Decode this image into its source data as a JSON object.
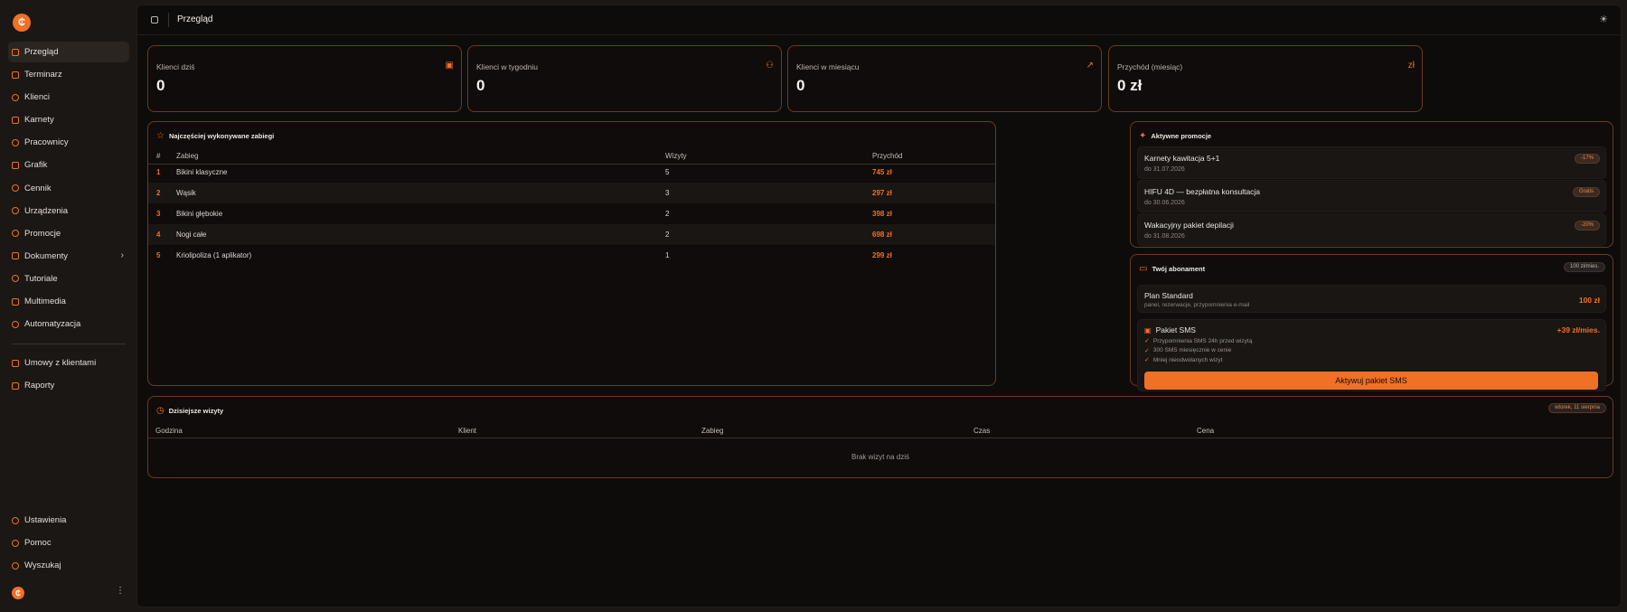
{
  "app": {
    "logo_char": "₵"
  },
  "sidebar": {
    "items": [
      {
        "label": "Przegląd"
      },
      {
        "label": "Terminarz"
      },
      {
        "label": "Klienci"
      },
      {
        "label": "Karnety"
      },
      {
        "label": "Pracownicy"
      },
      {
        "label": "Grafik"
      },
      {
        "label": "Cennik"
      },
      {
        "label": "Urządzenia"
      },
      {
        "label": "Promocje"
      },
      {
        "label": "Dokumenty"
      },
      {
        "label": "Tutoriale"
      },
      {
        "label": "Multimedia"
      },
      {
        "label": "Automatyzacja"
      }
    ],
    "secondary": [
      {
        "label": "Umowy z klientami"
      },
      {
        "label": "Raporty"
      }
    ],
    "bottom": [
      {
        "label": "Ustawienia"
      },
      {
        "label": "Pomoc"
      },
      {
        "label": "Wyszukaj"
      }
    ],
    "chevron": "›",
    "user_menu": "⋮"
  },
  "header": {
    "title": "Przegląd",
    "theme_icon": "☀"
  },
  "stats": [
    {
      "label": "Klienci dziś",
      "value": "0",
      "icon": "▣"
    },
    {
      "label": "Klienci w tygodniu",
      "value": "0",
      "icon": "⚇"
    },
    {
      "label": "Klienci w miesiącu",
      "value": "0",
      "icon": "↗"
    },
    {
      "label": "Przychód (miesiąc)",
      "value": "0 zł",
      "icon": "zł"
    }
  ],
  "treatments": {
    "title": "Najczęściej wykonywane zabiegi",
    "icon": "☆",
    "columns": [
      "#",
      "Zabieg",
      "Wizyty",
      "Przychód"
    ],
    "rows": [
      {
        "n": "1",
        "name": "Bikini klasyczne",
        "visits": "5",
        "revenue": "745 zł"
      },
      {
        "n": "2",
        "name": "Wąsik",
        "visits": "3",
        "revenue": "297 zł"
      },
      {
        "n": "3",
        "name": "Bikini głębokie",
        "visits": "2",
        "revenue": "398 zł"
      },
      {
        "n": "4",
        "name": "Nogi całe",
        "visits": "2",
        "revenue": "698 zł"
      },
      {
        "n": "5",
        "name": "Kriolipoliza (1 aplikator)",
        "visits": "1",
        "revenue": "299 zł"
      }
    ]
  },
  "promotions": {
    "title": "Aktywne promocje",
    "icon": "✦",
    "items": [
      {
        "name": "Karnety kawitacja 5+1",
        "date": "do 31.07.2026",
        "badge": "-17%"
      },
      {
        "name": "HIFU 4D — bezpłatna konsultacja",
        "date": "do 30.06.2026",
        "badge": "Gratis"
      },
      {
        "name": "Wakacyjny pakiet depilacji",
        "date": "do 31.08.2026",
        "badge": "-20%"
      }
    ]
  },
  "subscription": {
    "title": "Twój abonament",
    "icon": "▭",
    "badge": "100 zł/mies.",
    "plan": {
      "name": "Plan Standard",
      "desc": "panel, rezerwacje, przypomnienia e-mail",
      "price": "100 zł"
    },
    "sms": {
      "title": "Pakiet SMS",
      "icon": "▣",
      "price": "+39 zł/mies.",
      "features": [
        "Przypomnienia SMS 24h przed wizytą",
        "300 SMS miesięcznie w cenie",
        "Mniej nieodwołanych wizyt"
      ],
      "button": "Aktywuj pakiet SMS"
    }
  },
  "visits": {
    "title": "Dzisiejsze wizyty",
    "icon": "◷",
    "date_badge": "wtorek, 11 sierpnia",
    "columns": [
      "Godzina",
      "Klient",
      "Zabieg",
      "Czas",
      "Cena"
    ],
    "empty": "Brak wizyt na dziś"
  }
}
